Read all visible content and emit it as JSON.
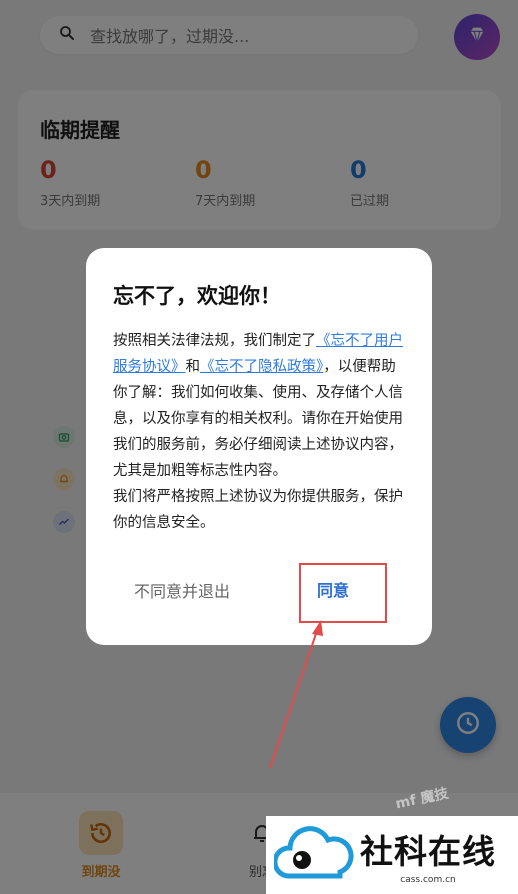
{
  "search": {
    "placeholder": "查找放哪了，过期没..."
  },
  "header": {
    "vip_icon": "diamond-icon"
  },
  "reminder": {
    "title": "临期提醒",
    "stats": [
      {
        "value": "0",
        "label": "3天内到期",
        "color": "#d9463a"
      },
      {
        "value": "0",
        "label": "7天内到期",
        "color": "#e08a1f"
      },
      {
        "value": "0",
        "label": "已过期",
        "color": "#2979d6"
      }
    ]
  },
  "side_icons": [
    "camera-icon",
    "bell-icon",
    "trend-icon"
  ],
  "fab": {
    "icon": "clock-icon"
  },
  "bottom_nav": {
    "items": [
      {
        "label": "到期没",
        "icon": "history-icon",
        "active": true
      },
      {
        "label": "别忘",
        "icon": "bell-icon",
        "active": false
      }
    ]
  },
  "dialog": {
    "title": "忘不了，欢迎你！",
    "body": {
      "p1_a": "按照相关法律法规，我们制定了",
      "link_terms": "《忘不了用户服务协议》",
      "p1_and": "和",
      "link_privacy": "《忘不了隐私政策》",
      "p1_b": "，以便帮助你了解：我们如何收集、使用、及存储个人信息，以及你享有的相关权利。请你在开始使用我们的服务前，务必仔细阅读上述协议内容，尤其是加粗等标志性内容。",
      "p2": "我们将严格按照上述协议为你提供服务，保护你的信息安全。"
    },
    "decline_label": "不同意并退出",
    "agree_label": "同意"
  },
  "watermark": {
    "title": "社科在线",
    "sub": "cass.com.cn",
    "faint": "mf 魔技"
  }
}
